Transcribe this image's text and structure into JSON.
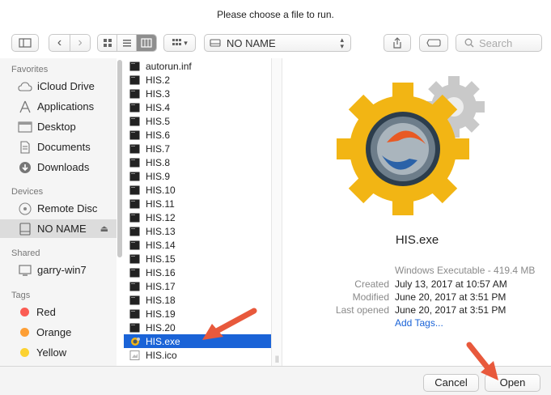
{
  "dialog": {
    "title": "Please choose a file to run."
  },
  "toolbar": {
    "location": "NO NAME",
    "search_placeholder": "Search"
  },
  "sidebar": {
    "favorites_header": "Favorites",
    "favorites": [
      {
        "label": "iCloud Drive",
        "icon": "cloud-icon"
      },
      {
        "label": "Applications",
        "icon": "applications-icon"
      },
      {
        "label": "Desktop",
        "icon": "desktop-icon"
      },
      {
        "label": "Documents",
        "icon": "documents-icon"
      },
      {
        "label": "Downloads",
        "icon": "downloads-icon"
      }
    ],
    "devices_header": "Devices",
    "devices": [
      {
        "label": "Remote Disc",
        "icon": "disc-icon"
      },
      {
        "label": "NO NAME",
        "icon": "drive-icon"
      }
    ],
    "shared_header": "Shared",
    "shared": [
      {
        "label": "garry-win7",
        "icon": "monitor-icon"
      }
    ],
    "tags_header": "Tags",
    "tags": [
      {
        "label": "Red",
        "color": "#fb5c53"
      },
      {
        "label": "Orange",
        "color": "#fd9f36"
      },
      {
        "label": "Yellow",
        "color": "#fcd232"
      }
    ]
  },
  "files": [
    "autorun.inf",
    "HIS.2",
    "HIS.3",
    "HIS.4",
    "HIS.5",
    "HIS.6",
    "HIS.7",
    "HIS.8",
    "HIS.9",
    "HIS.10",
    "HIS.11",
    "HIS.12",
    "HIS.13",
    "HIS.14",
    "HIS.15",
    "HIS.16",
    "HIS.17",
    "HIS.18",
    "HIS.19",
    "HIS.20",
    "HIS.exe",
    "HIS.ico"
  ],
  "selected_file": "HIS.exe",
  "preview": {
    "name": "HIS.exe",
    "kind": "Windows Executable - 419.4 MB",
    "created_label": "Created",
    "created": "July 13, 2017 at 10:57 AM",
    "modified_label": "Modified",
    "modified": "June 20, 2017 at 3:51 PM",
    "last_opened_label": "Last opened",
    "last_opened": "June 20, 2017 at 3:51 PM",
    "add_tags": "Add Tags..."
  },
  "buttons": {
    "cancel": "Cancel",
    "open": "Open"
  },
  "colors": {
    "selection": "#1a63d7",
    "arrow": "#e8593c",
    "gear_gold": "#f2b514",
    "gear_gray": "#c8c8c8"
  }
}
